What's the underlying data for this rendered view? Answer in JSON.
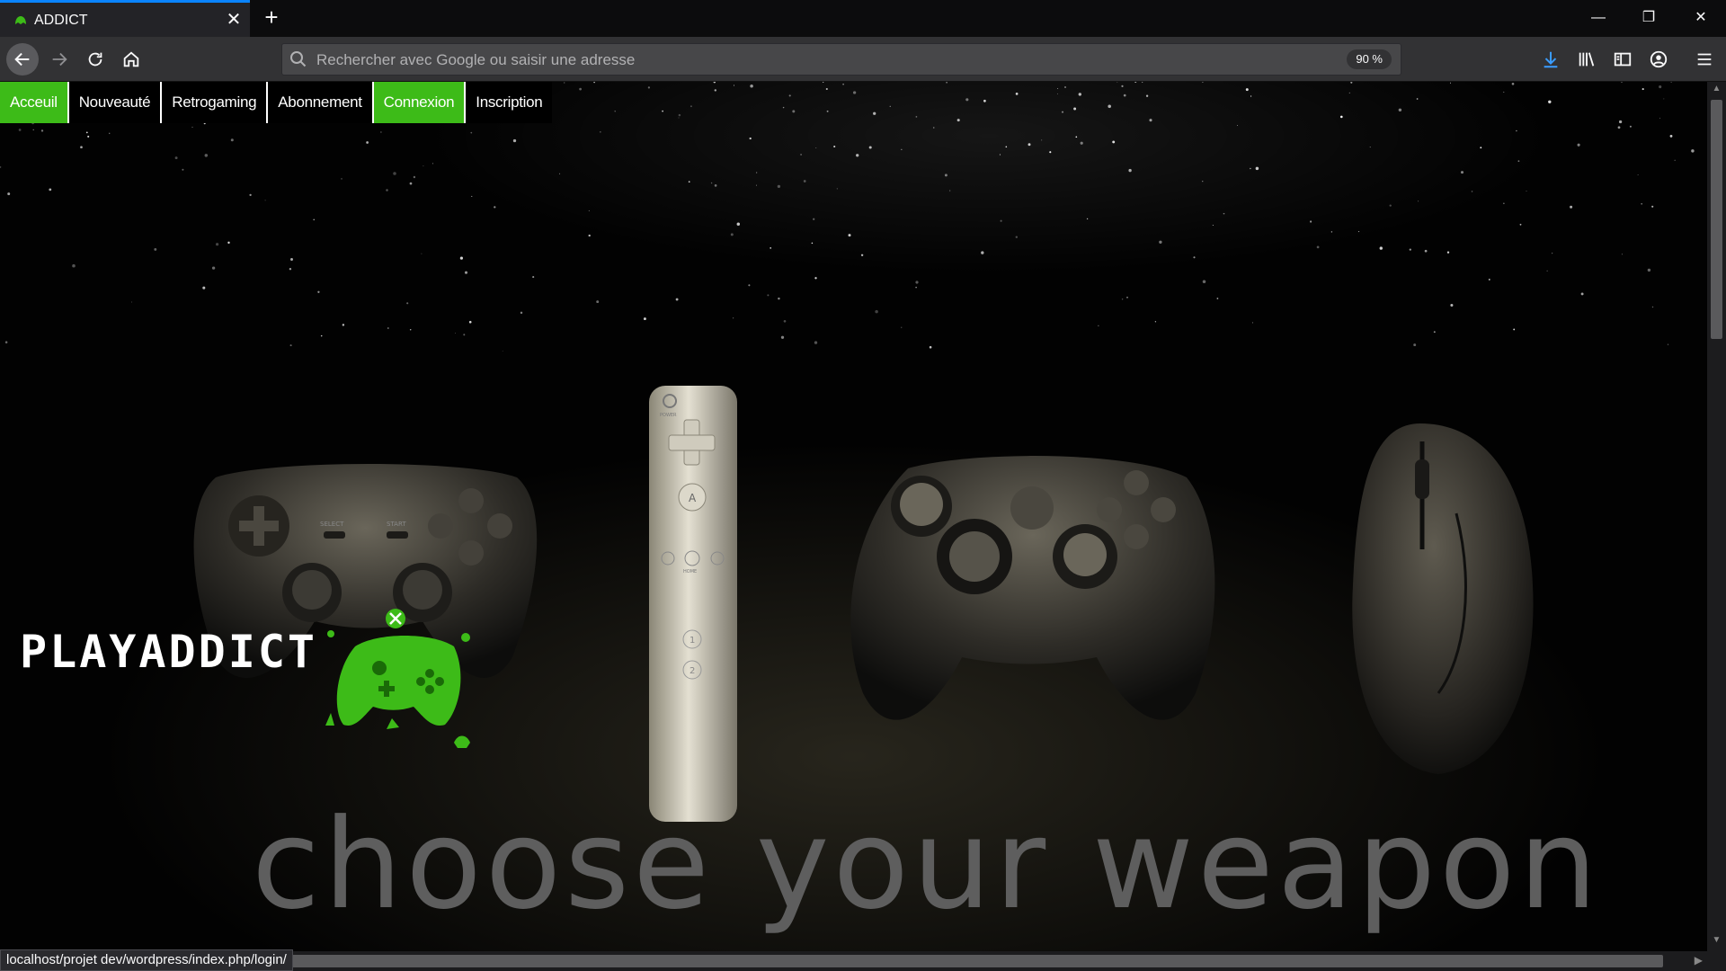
{
  "browser": {
    "tab": {
      "title": "ADDICT",
      "close_label": "✕"
    },
    "new_tab_label": "+",
    "window_controls": {
      "minimize": "—",
      "restore": "❐",
      "close": "✕"
    },
    "url_bar": {
      "placeholder": "Rechercher avec Google ou saisir une adresse",
      "zoom": "90 %"
    },
    "status_url": "localhost/projet dev/wordpress/index.php/login/",
    "icons": [
      "back-icon",
      "forward-icon",
      "reload-icon",
      "home-icon",
      "search-icon",
      "download-icon",
      "library-icon",
      "sidebar-icon",
      "account-icon",
      "menu-icon"
    ],
    "accent_color": "#0a84ff"
  },
  "site": {
    "menu": [
      {
        "label": "Acceuil",
        "active": true
      },
      {
        "label": "Nouveauté",
        "active": false
      },
      {
        "label": "Retrogaming",
        "active": false
      },
      {
        "label": "Abonnement",
        "active": false
      },
      {
        "label": "Connexion",
        "active": true
      },
      {
        "label": "Inscription",
        "active": false
      }
    ],
    "brand": "PLAYADDICT",
    "tagline": "choose your weapon",
    "controller_labels": {
      "ps_select": "SELECT",
      "ps_start": "START",
      "wii_power": "POWER",
      "wii_a": "A",
      "wii_home": "HOME",
      "wii_one": "1",
      "wii_two": "2"
    },
    "accent_color": "#3dbb18"
  }
}
